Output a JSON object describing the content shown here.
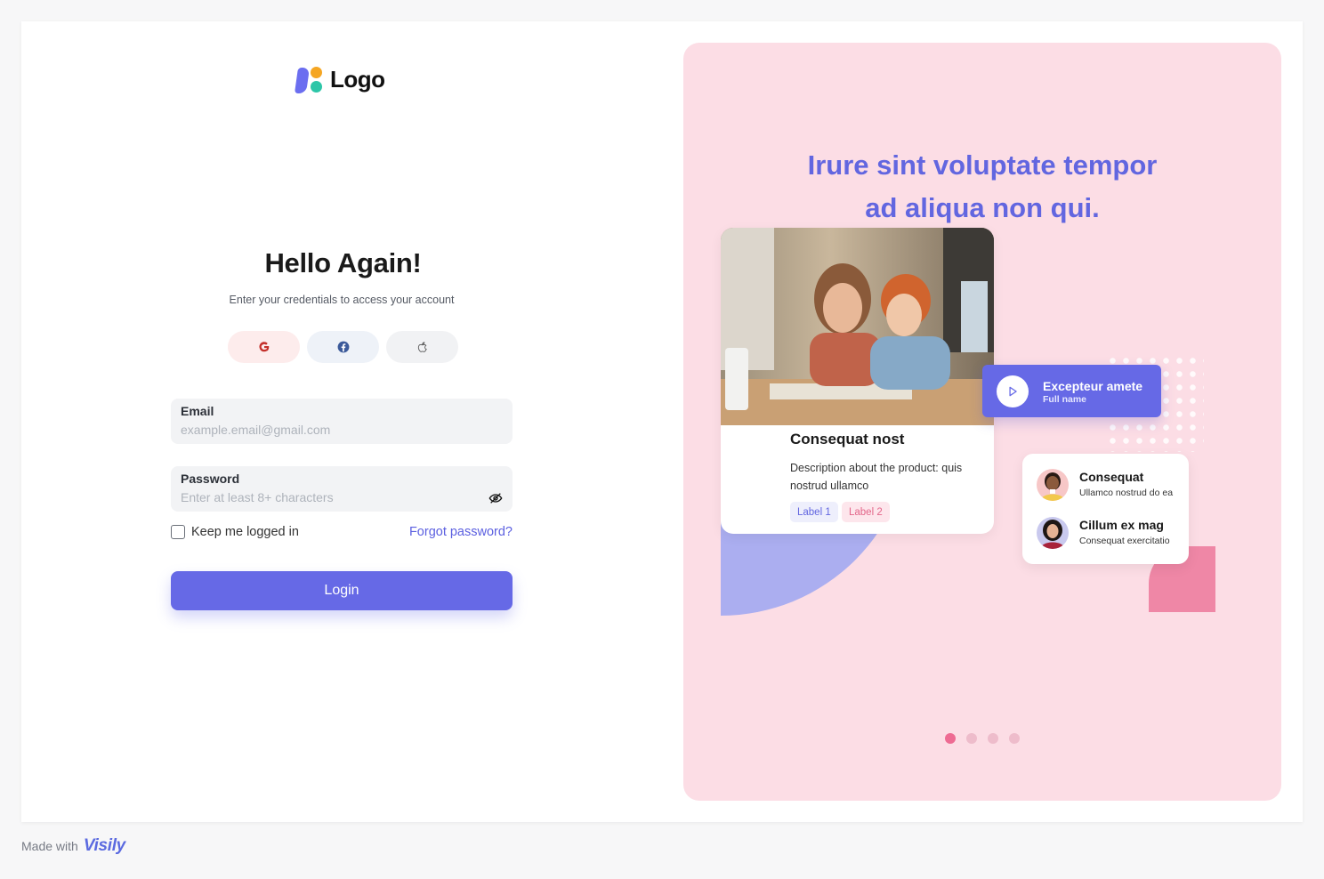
{
  "brand": {
    "logo_text": "Logo"
  },
  "login": {
    "title": "Hello Again!",
    "subtitle": "Enter your credentials to access your account",
    "social": [
      {
        "icon": "google-icon",
        "color": "#d0312d"
      },
      {
        "icon": "facebook-icon",
        "color": "#3b5998"
      },
      {
        "icon": "apple-icon",
        "color": "#555555"
      }
    ],
    "email": {
      "label": "Email",
      "placeholder": "example.email@gmail.com",
      "value": ""
    },
    "password": {
      "label": "Password",
      "placeholder": "Enter at least 8+ characters",
      "value": ""
    },
    "remember_label": "Keep me logged in",
    "remember_checked": false,
    "forgot_label": "Forgot password?",
    "submit_label": "Login"
  },
  "hero": {
    "tagline_line1": "Irure sint voluptate tempor",
    "tagline_line2": "ad aliqua non qui.",
    "product": {
      "title": "Consequat nost",
      "description": "Description about the product: quis nostrud ullamco",
      "tags": [
        "Label 1",
        "Label 2"
      ]
    },
    "video": {
      "title": "Excepteur amete",
      "subtitle": "Full name"
    },
    "people": [
      {
        "name": "Consequat",
        "detail": "Ullamco nostrud do ea"
      },
      {
        "name": "Cillum ex mag",
        "detail": "Consequat exercitatio"
      }
    ],
    "pager": {
      "total": 4,
      "active": 1
    }
  },
  "footer": {
    "made_with": "Made with",
    "brand": "Visily"
  },
  "colors": {
    "accent": "#6669e6",
    "hero_bg": "#fcdde5",
    "pink": "#ee6b93"
  }
}
